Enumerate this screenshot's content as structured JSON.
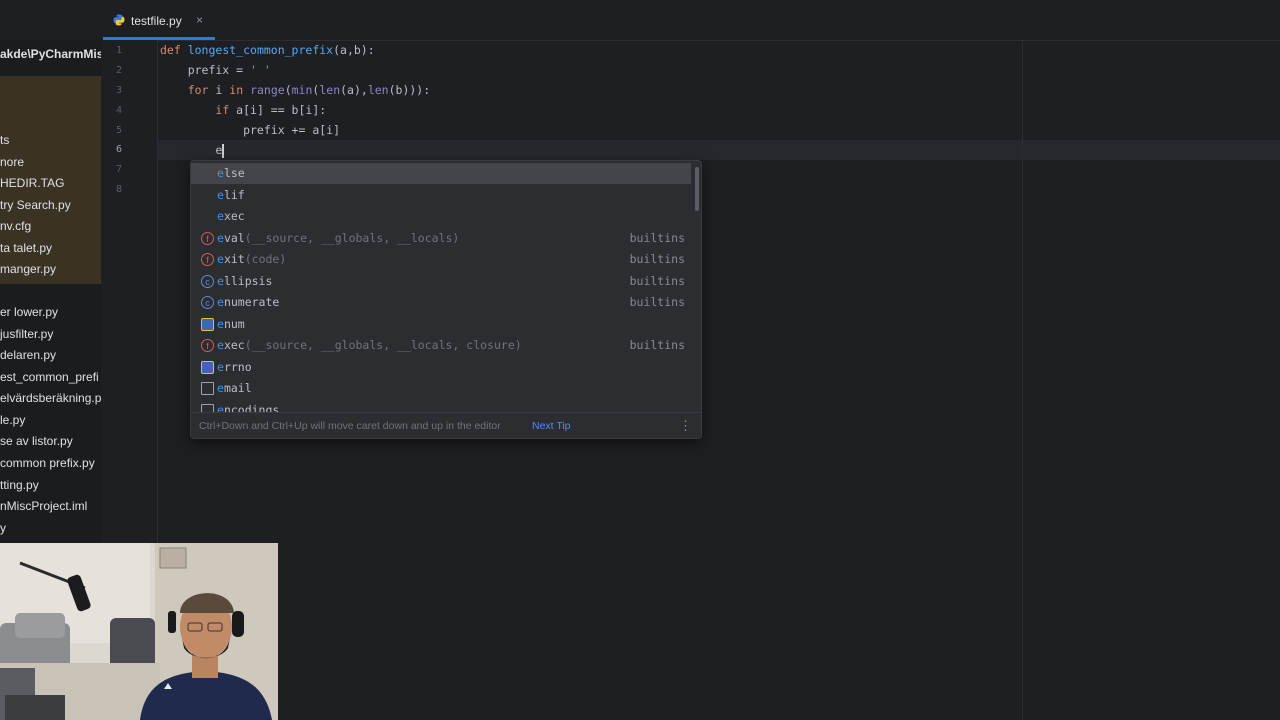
{
  "tab": {
    "filename": "testfile.py",
    "close": "×"
  },
  "sidebar": {
    "items": [
      "akde\\PyCharmMis",
      "ts",
      "nore",
      "HEDIR.TAG",
      "try Search.py",
      "nv.cfg",
      "ta talet.py",
      "manger.py",
      "er lower.py",
      "jusfilter.py",
      "delaren.py",
      "est_common_prefi",
      "elvärdsberäkning.p",
      "le.py",
      "se av listor.py",
      " common prefix.py",
      "tting.py",
      "nMiscProject.iml",
      "y"
    ]
  },
  "gutter": {
    "line_numbers": [
      "1",
      "2",
      "3",
      "4",
      "5",
      "6",
      "7",
      "8"
    ]
  },
  "code": {
    "line1": {
      "kw": "def ",
      "fn": "longest_common_prefix",
      "rest": "(a,b):"
    },
    "line2": {
      "text": "    prefix = ",
      "str": "' '"
    },
    "line3": {
      "indent": "    ",
      "kw1": "for",
      "mid": " i ",
      "kw2": "in",
      "sp": " ",
      "b1": "range",
      "p1": "(",
      "b2": "min",
      "p2": "(",
      "b3": "len",
      "p3": "(a),",
      "b4": "len",
      "p4": "(b))):"
    },
    "line4": {
      "indent": "        ",
      "kw": "if",
      "rest": " a[i] == b[i]:"
    },
    "line5": {
      "text": "            prefix += a[i]"
    },
    "line6": {
      "indent": "        ",
      "typed": "e"
    }
  },
  "completion": {
    "items": [
      {
        "match": "e",
        "rest": "lse",
        "sig": "",
        "source": "",
        "icon": "none"
      },
      {
        "match": "e",
        "rest": "lif",
        "sig": "",
        "source": "",
        "icon": "none"
      },
      {
        "match": "e",
        "rest": "xec",
        "sig": "",
        "source": "",
        "icon": "none"
      },
      {
        "match": "e",
        "rest": "val",
        "sig": "(__source, __globals, __locals)",
        "source": "builtins",
        "icon": "function-icon"
      },
      {
        "match": "e",
        "rest": "xit",
        "sig": "(code)",
        "source": "builtins",
        "icon": "function-icon"
      },
      {
        "match": "e",
        "rest": "llipsis",
        "sig": "",
        "source": "builtins",
        "icon": "class-icon"
      },
      {
        "match": "e",
        "rest": "numerate",
        "sig": "",
        "source": "builtins",
        "icon": "class-icon"
      },
      {
        "match": "e",
        "rest": "num",
        "sig": "",
        "source": "",
        "icon": "python-module-icon"
      },
      {
        "match": "e",
        "rest": "xec",
        "sig": "(__source, __globals, __locals, closure)",
        "source": "builtins",
        "icon": "function-icon"
      },
      {
        "match": "e",
        "rest": "rrno",
        "sig": "",
        "source": "",
        "icon": "python-module-icon"
      },
      {
        "match": "e",
        "rest": "mail",
        "sig": "",
        "source": "",
        "icon": "package-icon"
      },
      {
        "match": "e",
        "rest": "ncodings",
        "sig": "",
        "source": "",
        "icon": "package-icon"
      }
    ],
    "footer_tip": "Ctrl+Down and Ctrl+Up will move caret down and up in the editor",
    "next_tip": "Next Tip",
    "menu_glyph": "⋮"
  },
  "colors": {
    "keyword": "#cf8e6d",
    "function": "#56a8f5",
    "builtin": "#8888c6",
    "string": "#6aab73",
    "match_highlight": "#3b94ef",
    "accent": "#3574f0"
  }
}
